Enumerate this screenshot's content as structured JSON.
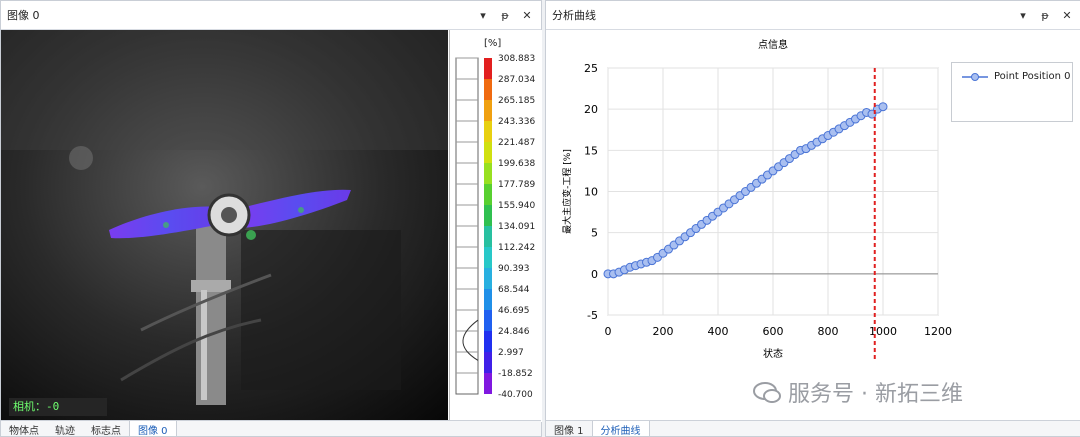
{
  "left_panel": {
    "title": "图像 0",
    "controls": [
      "▾",
      "ᵽ",
      "✕"
    ],
    "camera_label": "相机：-0",
    "scale_unit": "[%]",
    "scale_values": [
      "308.883",
      "287.034",
      "265.185",
      "243.336",
      "221.487",
      "199.638",
      "177.789",
      "155.940",
      "134.091",
      "112.242",
      "90.393",
      "68.544",
      "46.695",
      "24.846",
      "2.997",
      "-18.852",
      "-40.700"
    ],
    "tabs": [
      "物体点",
      "轨迹",
      "标志点",
      "图像 0"
    ]
  },
  "right_panel": {
    "title": "分析曲线",
    "controls": [
      "▾",
      "ᵽ",
      "✕"
    ],
    "tabs": [
      "图像 1",
      "分析曲线"
    ]
  },
  "chart_data": {
    "type": "scatter",
    "title": "点信息",
    "xlabel": "状态",
    "ylabel": "最大主应变-工程 [%]",
    "xlim": [
      0,
      1200
    ],
    "ylim": [
      -5,
      25
    ],
    "xticks": [
      0,
      200,
      400,
      600,
      800,
      1000,
      1200
    ],
    "yticks": [
      -5,
      0,
      5,
      10,
      15,
      20,
      25
    ],
    "grid": true,
    "legend_position": "top-right",
    "marker_line_x": 970,
    "series": [
      {
        "name": "Point Position 0",
        "color": "#4a74d6",
        "x": [
          0,
          20,
          40,
          60,
          80,
          100,
          120,
          140,
          160,
          180,
          200,
          220,
          240,
          260,
          280,
          300,
          320,
          340,
          360,
          380,
          400,
          420,
          440,
          460,
          480,
          500,
          520,
          540,
          560,
          580,
          600,
          620,
          640,
          660,
          680,
          700,
          720,
          740,
          760,
          780,
          800,
          820,
          840,
          860,
          880,
          900,
          920,
          940,
          960,
          980,
          1000
        ],
        "y": [
          0,
          0,
          0.2,
          0.5,
          0.8,
          1,
          1.2,
          1.4,
          1.6,
          2,
          2.5,
          3,
          3.5,
          4,
          4.5,
          5,
          5.5,
          6,
          6.5,
          7,
          7.5,
          8,
          8.5,
          9,
          9.5,
          10,
          10.5,
          11,
          11.5,
          12,
          12.5,
          13,
          13.5,
          14,
          14.5,
          15,
          15.2,
          15.6,
          16,
          16.4,
          16.8,
          17.2,
          17.6,
          18,
          18.4,
          18.8,
          19.2,
          19.6,
          19.4,
          20,
          20.3
        ]
      }
    ]
  },
  "watermark": "服务号 · 新拓三维"
}
